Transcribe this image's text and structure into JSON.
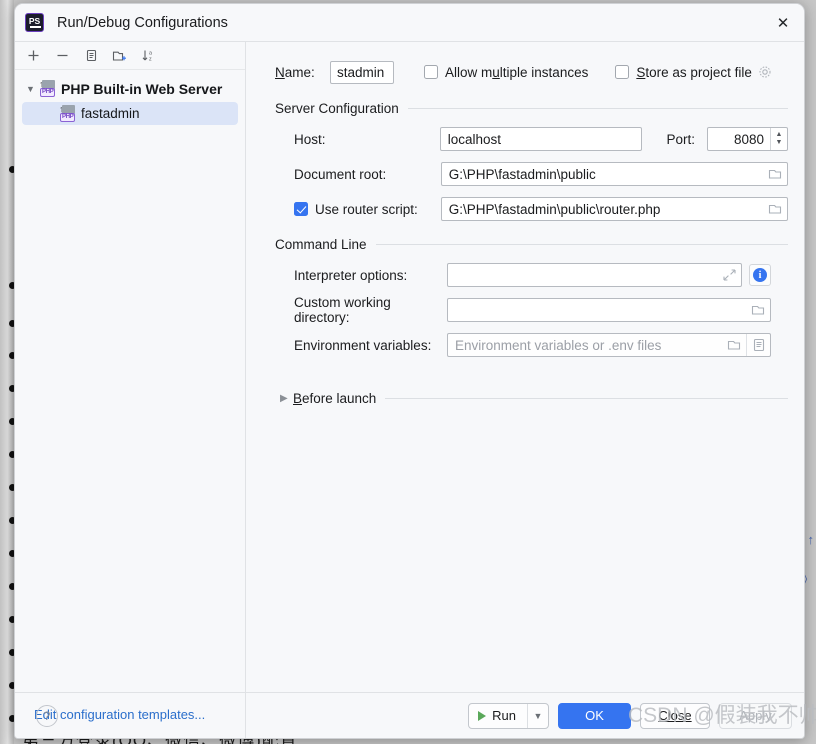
{
  "window": {
    "title": "Run/Debug Configurations",
    "app_icon": "phpstorm-ps-icon",
    "close_icon": "close-icon"
  },
  "left_panel": {
    "toolbar": [
      {
        "name": "add-button",
        "icon": "plus-icon"
      },
      {
        "name": "remove-button",
        "icon": "minus-icon"
      },
      {
        "name": "copy-button",
        "icon": "copy-icon"
      },
      {
        "name": "new-folder-button",
        "icon": "new-folder-icon"
      },
      {
        "name": "sort-button",
        "icon": "sort-alphabetically-icon"
      }
    ],
    "tree": {
      "group_label": "PHP Built-in Web Server",
      "group_expanded": true,
      "child_label": "fastadmin",
      "child_selected": true
    },
    "edit_templates_link": "Edit configuration templates..."
  },
  "form": {
    "name_label": "Name:",
    "name_value": "stadmin",
    "allow_multiple_instances_label": "Allow multiple instances",
    "allow_multiple_instances_checked": false,
    "store_as_project_file_label": "Store as project file",
    "store_as_project_file_checked": false,
    "store_gear_icon": "gear-icon",
    "server_configuration_title": "Server Configuration",
    "host_label": "Host:",
    "host_value": "localhost",
    "port_label": "Port:",
    "port_value": "8080",
    "document_root_label": "Document root:",
    "document_root_value": "G:\\PHP\\fastadmin\\public",
    "use_router_script_label": "Use router script:",
    "use_router_script_checked": true,
    "router_script_value": "G:\\PHP\\fastadmin\\public\\router.php",
    "command_line_title": "Command Line",
    "interpreter_options_label": "Interpreter options:",
    "interpreter_options_value": "",
    "interpreter_options_placeholder": "",
    "custom_working_directory_label": "Custom working directory:",
    "custom_working_directory_value": "",
    "custom_working_directory_placeholder": "",
    "environment_variables_label": "Environment variables:",
    "environment_variables_value": "",
    "environment_variables_placeholder": "Environment variables or .env files",
    "before_launch_label": "Before launch",
    "before_launch_expanded": false
  },
  "footer": {
    "help_label": "?",
    "run_label": "Run",
    "run_icon": "play-icon",
    "run_dropdown_icon": "chevron-down-icon",
    "ok_label": "OK",
    "close_label": "Close",
    "apply_label": "Apply",
    "apply_disabled": true
  },
  "background": {
    "watermark": "CSDN @假装我不帅",
    "bottom_text": "第三方登录(QQ、微信、微博)配置",
    "bullet_positions": [
      166,
      282,
      320,
      352,
      385,
      418,
      451,
      484,
      517,
      550,
      583,
      616,
      649,
      682,
      715
    ],
    "right_glyphs": [
      "↑",
      "》"
    ]
  },
  "colors": {
    "accent": "#3574f0",
    "selection": "#dbe4f7",
    "link": "#2a6ecb",
    "dialog_bg": "#f7f8fa",
    "run_green": "#5aa85a"
  }
}
